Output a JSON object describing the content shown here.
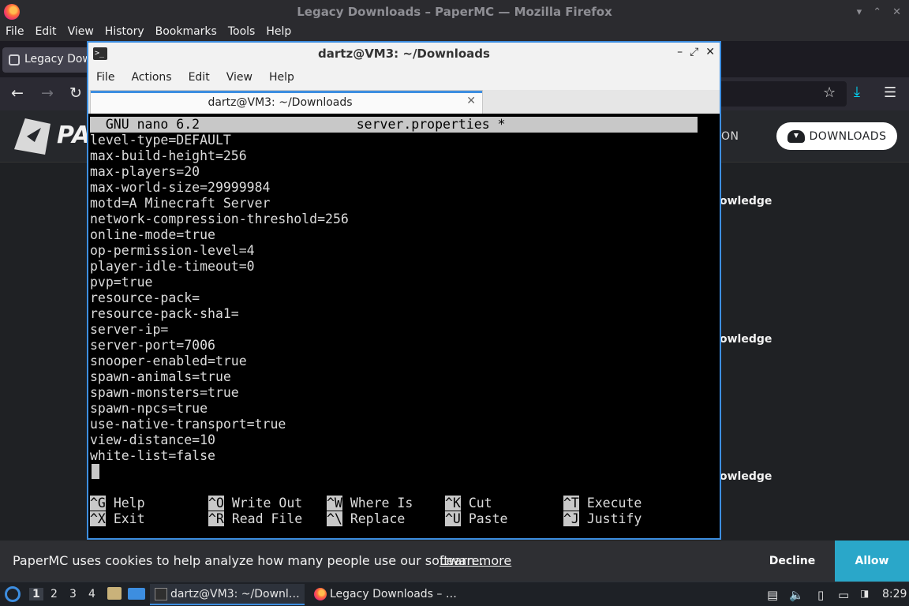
{
  "firefox": {
    "window_title": "Legacy Downloads – PaperMC — Mozilla Firefox",
    "menu": [
      "File",
      "Edit",
      "View",
      "History",
      "Bookmarks",
      "Tools",
      "Help"
    ],
    "tab_title": "Legacy Dow"
  },
  "page": {
    "logo_text": "PA",
    "nav_item": "ON",
    "downloads_button": "DOWNLOADS",
    "knowledge_items": [
      "owledge",
      "owledge",
      "owledge"
    ]
  },
  "cookie": {
    "message": "PaperMC uses cookies to help analyze how many people use our software.",
    "learn_more": "Learn more",
    "decline": "Decline",
    "allow": "Allow"
  },
  "terminal": {
    "window_title": "dartz@VM3: ~/Downloads",
    "menu": [
      "File",
      "Actions",
      "Edit",
      "View",
      "Help"
    ],
    "tab_title": "dartz@VM3: ~/Downloads",
    "nano": {
      "header": "  GNU nano 6.2                    server.properties *",
      "lines": [
        "level-type=DEFAULT",
        "max-build-height=256",
        "max-players=20",
        "max-world-size=29999984",
        "motd=A Minecraft Server",
        "network-compression-threshold=256",
        "online-mode=true",
        "op-permission-level=4",
        "player-idle-timeout=0",
        "pvp=true",
        "resource-pack=",
        "resource-pack-sha1=",
        "server-ip=",
        "server-port=7006",
        "snooper-enabled=true",
        "spawn-animals=true",
        "spawn-monsters=true",
        "spawn-npcs=true",
        "use-native-transport=true",
        "view-distance=10",
        "white-list=false"
      ],
      "shortcuts_row1": [
        {
          "key": "^G",
          "label": "Help"
        },
        {
          "key": "^O",
          "label": "Write Out"
        },
        {
          "key": "^W",
          "label": "Where Is"
        },
        {
          "key": "^K",
          "label": "Cut"
        },
        {
          "key": "^T",
          "label": "Execute"
        }
      ],
      "shortcuts_row2": [
        {
          "key": "^X",
          "label": "Exit"
        },
        {
          "key": "^R",
          "label": "Read File"
        },
        {
          "key": "^\\",
          "label": "Replace"
        },
        {
          "key": "^U",
          "label": "Paste"
        },
        {
          "key": "^J",
          "label": "Justify"
        }
      ]
    }
  },
  "taskbar": {
    "workspaces": [
      "1",
      "2",
      "3",
      "4"
    ],
    "terminal_task": "dartz@VM3: ~/Downl…",
    "firefox_task": "Legacy Downloads – …",
    "clock": "8:29"
  }
}
